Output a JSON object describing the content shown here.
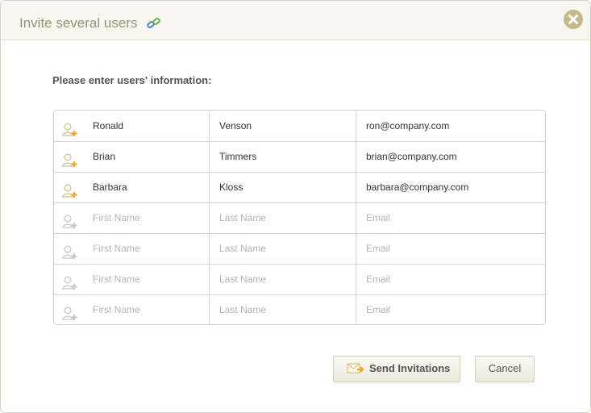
{
  "dialog": {
    "title": "Invite several users",
    "title_icon": "link-icon",
    "close_icon": "close-icon"
  },
  "prompt": "Please enter users' information:",
  "rows": [
    {
      "first": "Ronald",
      "last": "Venson",
      "email": "ron@company.com",
      "filled": true
    },
    {
      "first": "Brian",
      "last": "Timmers",
      "email": "brian@company.com",
      "filled": true
    },
    {
      "first": "Barbara",
      "last": "Kloss",
      "email": "barbara@company.com",
      "filled": true
    },
    {
      "first": "",
      "last": "",
      "email": "",
      "filled": false
    },
    {
      "first": "",
      "last": "",
      "email": "",
      "filled": false
    },
    {
      "first": "",
      "last": "",
      "email": "",
      "filled": false
    },
    {
      "first": "",
      "last": "",
      "email": "",
      "filled": false
    }
  ],
  "placeholders": {
    "first": "First Name",
    "last": "Last Name",
    "email": "Email"
  },
  "buttons": {
    "send": "Send Invitations",
    "cancel": "Cancel"
  },
  "colors": {
    "accent": "#c4b98a",
    "active_icon": "#f0a830",
    "header_bg": "#f8f6f0"
  }
}
